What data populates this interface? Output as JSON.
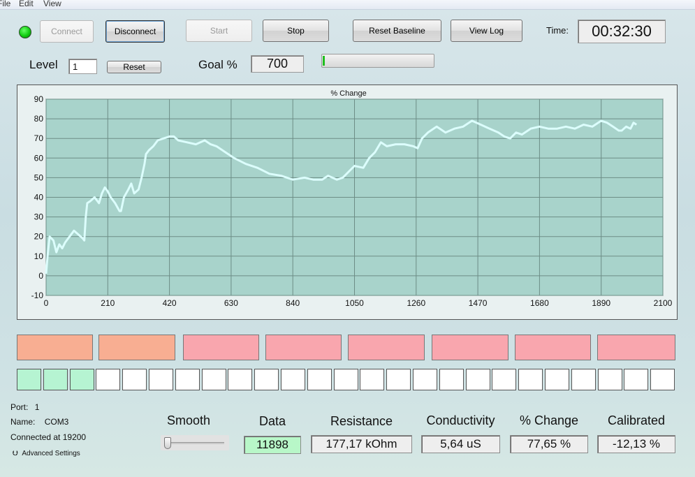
{
  "menu": {
    "file": "File",
    "edit": "Edit",
    "view": "View"
  },
  "toolbar": {
    "connect": "Connect",
    "disconnect": "Disconnect",
    "start": "Start",
    "stop": "Stop",
    "reset_baseline": "Reset Baseline",
    "view_log": "View Log",
    "time_label": "Time:",
    "time_value": "00:32:30"
  },
  "level": {
    "label": "Level",
    "value": "1",
    "reset": "Reset"
  },
  "goal": {
    "label": "Goal %",
    "value": "700",
    "progress": 0.01
  },
  "colors": {
    "plot_bg": "#a8d3cb",
    "series": "#dcfdfc",
    "orange_tile": "#f8ae92",
    "pink_tile": "#f9a6ae",
    "green_square": "#b6f4d2",
    "led": "#11cc11"
  },
  "chart_data": {
    "type": "line",
    "title": "% Change",
    "xlabel": "",
    "ylabel": "",
    "xlim": [
      0,
      2100
    ],
    "ylim": [
      -10,
      90
    ],
    "xticks": [
      0,
      210,
      420,
      630,
      840,
      1050,
      1260,
      1470,
      1680,
      1890,
      2100
    ],
    "yticks": [
      -10,
      0,
      10,
      20,
      30,
      40,
      50,
      60,
      70,
      80,
      90
    ],
    "grid": true,
    "series": [
      {
        "name": "",
        "x": [
          0,
          5,
          12,
          25,
          35,
          45,
          55,
          65,
          80,
          95,
          110,
          125,
          130,
          135,
          140,
          150,
          165,
          180,
          190,
          200,
          210,
          220,
          235,
          250,
          255,
          265,
          280,
          290,
          300,
          315,
          325,
          335,
          340,
          350,
          365,
          380,
          400,
          420,
          435,
          450,
          480,
          510,
          540,
          560,
          580,
          610,
          640,
          680,
          720,
          760,
          800,
          840,
          880,
          910,
          940,
          960,
          990,
          1010,
          1050,
          1080,
          1100,
          1120,
          1140,
          1160,
          1190,
          1220,
          1250,
          1265,
          1280,
          1300,
          1330,
          1360,
          1390,
          1420,
          1450,
          1480,
          1510,
          1540,
          1560,
          1580,
          1600,
          1620,
          1650,
          1680,
          1710,
          1740,
          1770,
          1800,
          1830,
          1860,
          1890,
          1910,
          1930,
          1950,
          1960,
          1975,
          1990,
          2000,
          2010
        ],
        "y": [
          1,
          10,
          20,
          18,
          12,
          16,
          14,
          17,
          20,
          23,
          21,
          19,
          18,
          30,
          37,
          38,
          40,
          37,
          42,
          45,
          43,
          40,
          37,
          33,
          33,
          40,
          44,
          47,
          42,
          44,
          50,
          57,
          62,
          64,
          66,
          69,
          70,
          71,
          71,
          69,
          68,
          67,
          69,
          67,
          66,
          63,
          60,
          57,
          55,
          52,
          51,
          49,
          50,
          49,
          49,
          51,
          49,
          50,
          56,
          55,
          60,
          63,
          68,
          66,
          67,
          67,
          66,
          65,
          70,
          73,
          76,
          73,
          75,
          76,
          79,
          77,
          75,
          73,
          71,
          70,
          73,
          72,
          75,
          76,
          75,
          75,
          76,
          75,
          77,
          76,
          79,
          78,
          76,
          74,
          74,
          76,
          75,
          78,
          77
        ]
      }
    ]
  },
  "level_tiles": [
    "orange",
    "orange",
    "pink",
    "pink",
    "pink",
    "pink",
    "pink",
    "pink"
  ],
  "progress_squares": {
    "total": 25,
    "filled": 3
  },
  "connection": {
    "port_label": "Port:",
    "port_value": "1",
    "name_label": "Name:",
    "name_value": "COM3",
    "status": "Connected at 19200",
    "advanced": "Advanced Settings"
  },
  "smooth": {
    "label": "Smooth",
    "value": 0
  },
  "stats": {
    "data": {
      "label": "Data",
      "value": "11898"
    },
    "resistance": {
      "label": "Resistance",
      "value": "177,17 kOhm"
    },
    "conductivity": {
      "label": "Conductivity",
      "value": "5,64 uS"
    },
    "pct_change": {
      "label": "% Change",
      "value": "77,65 %"
    },
    "calibrated": {
      "label": "Calibrated",
      "value": "-12,13 %"
    }
  }
}
